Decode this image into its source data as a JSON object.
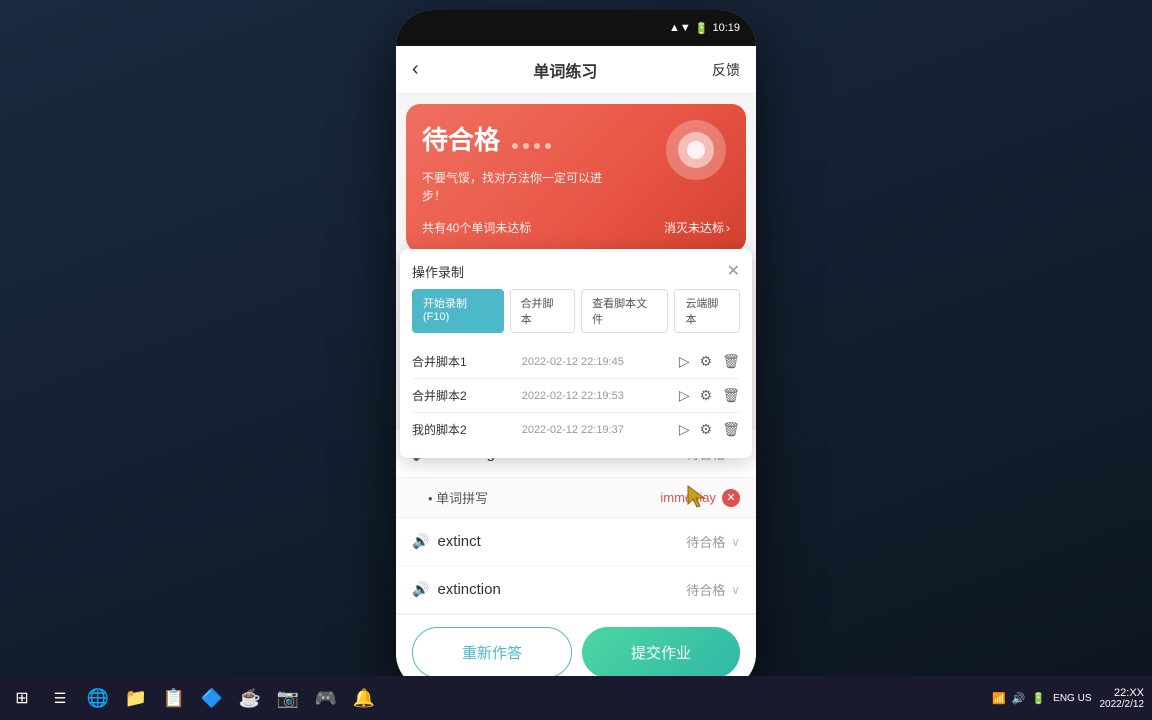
{
  "desktop": {
    "bg_color": "#1a2835"
  },
  "status_bar": {
    "time": "10:19",
    "signal": "▲",
    "wifi": "▼",
    "battery": "🔋"
  },
  "header": {
    "back_label": "‹",
    "title": "单词练习",
    "feedback_label": "反馈"
  },
  "banner": {
    "title": "待合格",
    "subtitle": "不要气馁，找对方法你一定可以进步！",
    "footer_count": "共有40个单词未达标",
    "footer_link": "消灭未达标",
    "footer_arrow": "›"
  },
  "operation_panel": {
    "title": "操作录制",
    "close_label": "✕",
    "tabs": [
      {
        "label": "开始录制(F10)",
        "active": true
      },
      {
        "label": "合并脚本",
        "active": false
      },
      {
        "label": "查看脚本文件",
        "active": false
      },
      {
        "label": "云端脚本",
        "active": false
      }
    ],
    "scripts": [
      {
        "name": "合并脚本1",
        "time": "2022-02-12 22:19:45"
      },
      {
        "name": "合并脚本2",
        "time": "2022-02-12 22:19:53"
      },
      {
        "name": "我的脚本2",
        "time": "2022-02-12 22:19:37"
      }
    ]
  },
  "words": [
    {
      "word": "alarming",
      "status": "待合格",
      "has_chevron": true,
      "sub_items": []
    },
    {
      "word": "单词拼写",
      "is_sub": true,
      "answer": "immediay",
      "wrong": true
    },
    {
      "word": "extinct",
      "status": "待合格",
      "has_chevron": true,
      "sub_items": []
    },
    {
      "word": "extinction",
      "status": "待合格",
      "has_chevron": true,
      "sub_items": []
    }
  ],
  "buttons": {
    "retry": "重新作答",
    "submit": "提交作业"
  },
  "taskbar": {
    "items": [
      {
        "icon": "⊞",
        "name": "start"
      },
      {
        "icon": "☰",
        "name": "task-view"
      },
      {
        "icon": "🌐",
        "name": "browser"
      },
      {
        "icon": "📁",
        "name": "explorer"
      },
      {
        "icon": "📰",
        "name": "news"
      },
      {
        "icon": "☕",
        "name": "java"
      },
      {
        "icon": "📷",
        "name": "camera"
      },
      {
        "icon": "🐉",
        "name": "app1"
      },
      {
        "icon": "🔔",
        "name": "app2"
      }
    ],
    "right": {
      "lang": "ENG US",
      "time": "22",
      "date": "2022/2/..."
    }
  }
}
